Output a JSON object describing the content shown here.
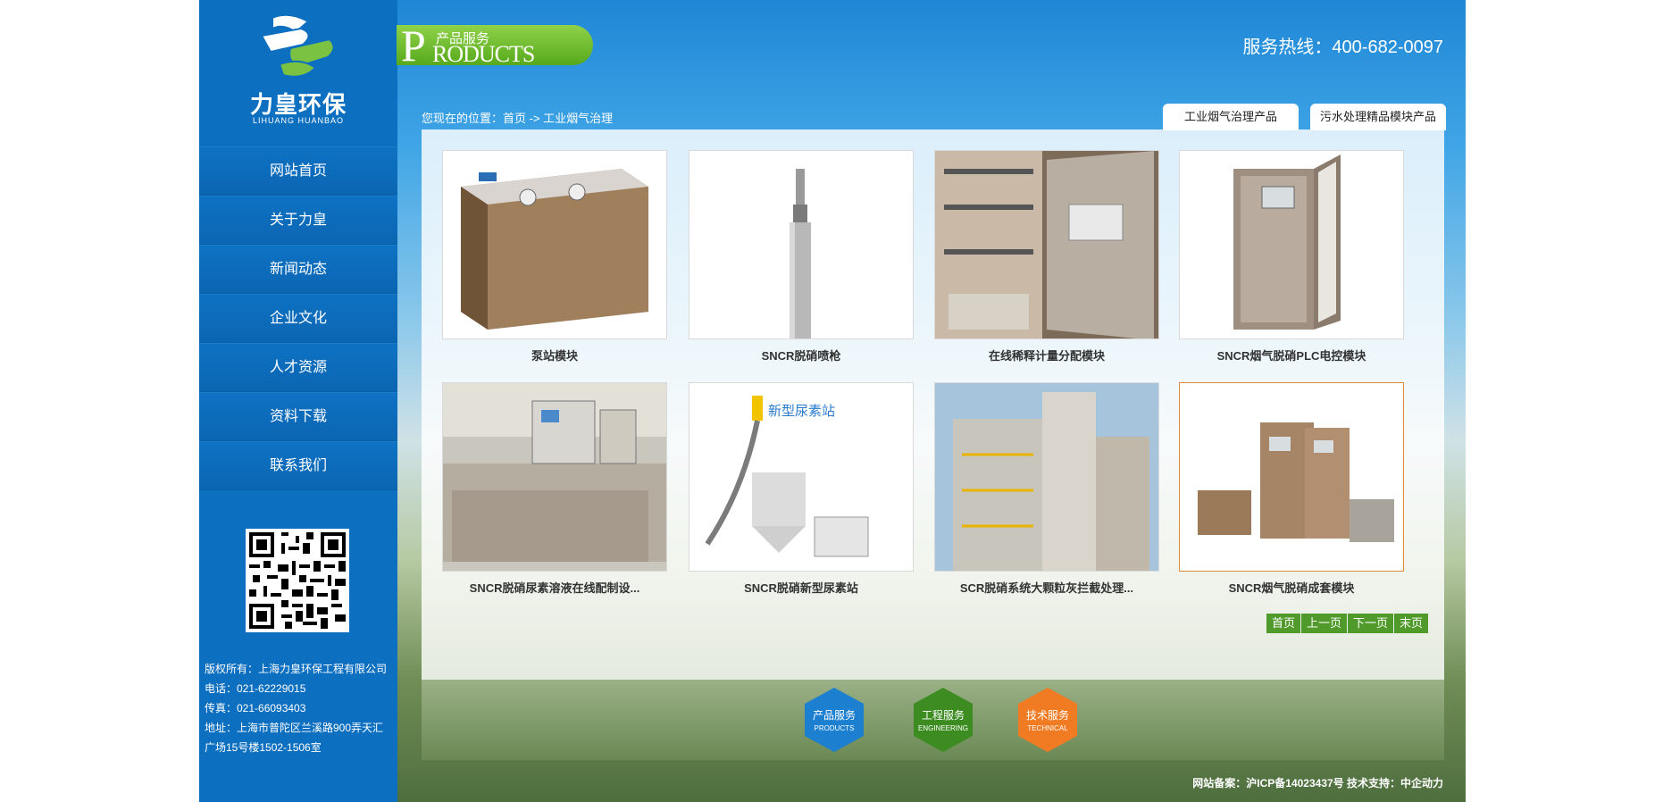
{
  "logo": {
    "cn": "力皇环保",
    "en": "LIHUANG HUANBAO"
  },
  "nav": [
    "网站首页",
    "关于力皇",
    "新闻动态",
    "企业文化",
    "人才资源",
    "资料下载",
    "联系我们"
  ],
  "contact": {
    "copyright": "版权所有：上海力皇环保工程有限公司",
    "phone": "电话：021-62229015",
    "fax": "传真：021-66093403",
    "address1": "地址：上海市普陀区兰溪路900弄天汇",
    "address2": "广场15号楼1502-1506室"
  },
  "badge": {
    "cn": "产品服务",
    "en": "RODUCTS",
    "p": "P"
  },
  "hotline": "服务热线：400-682-0097",
  "breadcrumb": "您现在的位置：首页 -> 工业烟气治理",
  "tabs": [
    "工业烟气治理产品",
    "污水处理精品模块产品"
  ],
  "products": [
    "泵站模块",
    "SNCR脱硝喷枪",
    "在线稀释计量分配模块",
    "SNCR烟气脱硝PLC电控模块",
    "SNCR脱硝尿素溶液在线配制设...",
    "SNCR脱硝新型尿素站",
    "SCR脱硝系统大颗粒灰拦截处理...",
    "SNCR烟气脱硝成套模块"
  ],
  "product_image_text": {
    "new_urea_station": "新型尿素站"
  },
  "pager": [
    "首页",
    "上一页",
    "下一页",
    "末页"
  ],
  "services": [
    {
      "cn": "产品服务",
      "en": "PRODUCTS",
      "color": "#1c7fd0"
    },
    {
      "cn": "工程服务",
      "en": "ENGINEERING",
      "color": "#3d8c22"
    },
    {
      "cn": "技术服务",
      "en": "TECHNICAL",
      "color": "#f07b22"
    }
  ],
  "icp": "网站备案：沪ICP备14023437号 技术支持：中企动力"
}
